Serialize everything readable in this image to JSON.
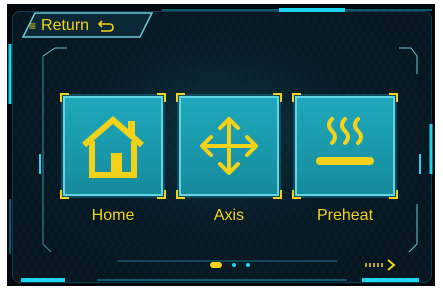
{
  "header": {
    "return_bullet": "≡",
    "return_label": "Return",
    "return_icon": "undo-arrow-icon"
  },
  "menu": {
    "items": [
      {
        "label": "Home",
        "icon": "house-icon"
      },
      {
        "label": "Axis",
        "icon": "move-arrows-icon"
      },
      {
        "label": "Preheat",
        "icon": "heat-waves-icon"
      }
    ]
  },
  "pagination": {
    "current_page": 1,
    "total_pages": 3
  },
  "colors": {
    "accent": "#f4d21a",
    "tile": "#1fa9bc",
    "frame": "#1dd3ef",
    "background": "#061620"
  }
}
